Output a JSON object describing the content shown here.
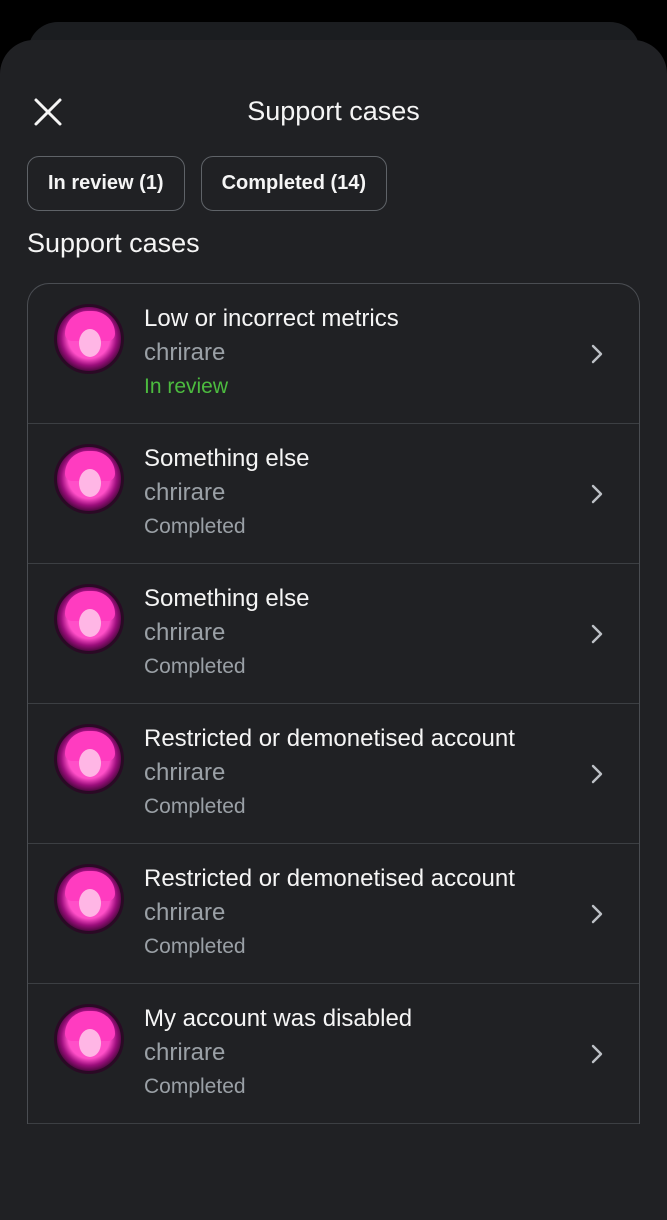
{
  "header": {
    "title": "Support cases"
  },
  "tabs": [
    {
      "label": "In review (1)"
    },
    {
      "label": "Completed (14)"
    }
  ],
  "section_title": "Support cases",
  "cases": [
    {
      "title": "Low or incorrect metrics",
      "user": "chrirare",
      "status": "In review"
    },
    {
      "title": "Something else",
      "user": "chrirare",
      "status": "Completed"
    },
    {
      "title": "Something else",
      "user": "chrirare",
      "status": "Completed"
    },
    {
      "title": "Restricted or demonetised account",
      "user": "chrirare",
      "status": "Completed"
    },
    {
      "title": "Restricted or demonetised account",
      "user": "chrirare",
      "status": "Completed"
    },
    {
      "title": "My account was disabled",
      "user": "chrirare",
      "status": "Completed"
    }
  ],
  "colors": {
    "background": "#202124",
    "status_in_review": "#4cbb3f",
    "status_completed": "#9aa0a6"
  },
  "icons": [
    "close-icon",
    "chevron-right-icon",
    "avatar"
  ]
}
